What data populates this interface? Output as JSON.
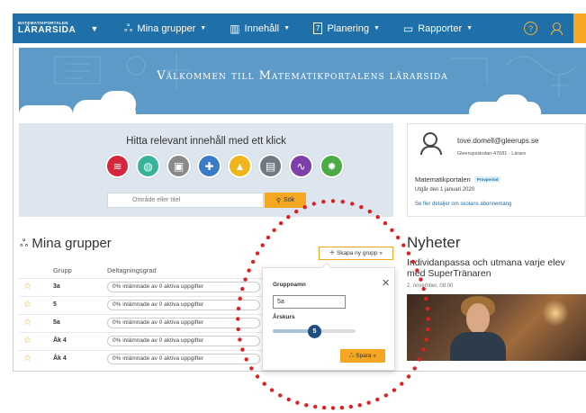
{
  "nav": {
    "brand_small": "MATEMATIKPORTALEN",
    "brand_big": "LÄRARSIDA",
    "items": [
      {
        "label": "Mina grupper",
        "icon": "group-icon"
      },
      {
        "label": "Innehåll",
        "icon": "book-icon"
      },
      {
        "label": "Planering",
        "icon": "calendar-icon"
      },
      {
        "label": "Rapporter",
        "icon": "report-icon"
      }
    ],
    "help_icon": "?",
    "calendar_day": "7"
  },
  "banner": {
    "title": "Välkommen till Matematikportalens lärarsida"
  },
  "search": {
    "title": "Hitta relevant innehåll med ett klick",
    "placeholder": "Område eller titel",
    "button_label": "Sök",
    "categories": [
      {
        "icon": "layers-icon",
        "color": "#d6263c",
        "glyph": "≋"
      },
      {
        "icon": "globe-icon",
        "color": "#36b39a",
        "glyph": "◍"
      },
      {
        "icon": "clapper-icon",
        "color": "#8a8a8a",
        "glyph": "▣"
      },
      {
        "icon": "puzzle-icon",
        "color": "#3a7bc8",
        "glyph": "✚"
      },
      {
        "icon": "cone-icon",
        "color": "#f1b51c",
        "glyph": "▲"
      },
      {
        "icon": "calculator-icon",
        "color": "#6f7a84",
        "glyph": "▤"
      },
      {
        "icon": "chart-icon",
        "color": "#7d3fa8",
        "glyph": "∿"
      },
      {
        "icon": "gears-icon",
        "color": "#4bab45",
        "glyph": "✹"
      }
    ]
  },
  "profile": {
    "email": "tove.domell@gleerups.se",
    "school": "Gleerupsskolan-47681 - Lärare",
    "product": "Matematikportalen",
    "badge": "Provperiod",
    "expires": "Utgår den 1 januari 2020",
    "link": "Se fler detaljer om skolans abonnemang"
  },
  "groups": {
    "title": "Mina grupper",
    "create_label": "Skapa ny grupp »",
    "col_group": "Grupp",
    "col_participation": "Deltagningsgrad",
    "rows": [
      {
        "name": "3a",
        "status": "0% inlämnade av 0 aktiva uppgifter"
      },
      {
        "name": "5",
        "status": "0% inlämnade av 0 aktiva uppgifter"
      },
      {
        "name": "5a",
        "status": "0% inlämnade av 0 aktiva uppgifter"
      },
      {
        "name": "Åk 4",
        "status": "0% inlämnade av 0 aktiva uppgifter"
      },
      {
        "name": "Åk 4",
        "status": "0% inlämnade av 0 aktiva uppgifter"
      }
    ]
  },
  "popup": {
    "name_label": "Gruppnamn",
    "name_value": "5a",
    "year_label": "Årskurs",
    "year_value": "5",
    "year_fraction": 0.5,
    "save_label": "Spara »"
  },
  "news": {
    "title": "Nyheter",
    "headline": "Individanpassa och utmana varje elev med SuperTränaren",
    "date": "2. november, 08:00"
  },
  "colors": {
    "nav_blue": "#1f6fa8",
    "accent_orange": "#f5a623",
    "annotation_red": "#e02020"
  }
}
